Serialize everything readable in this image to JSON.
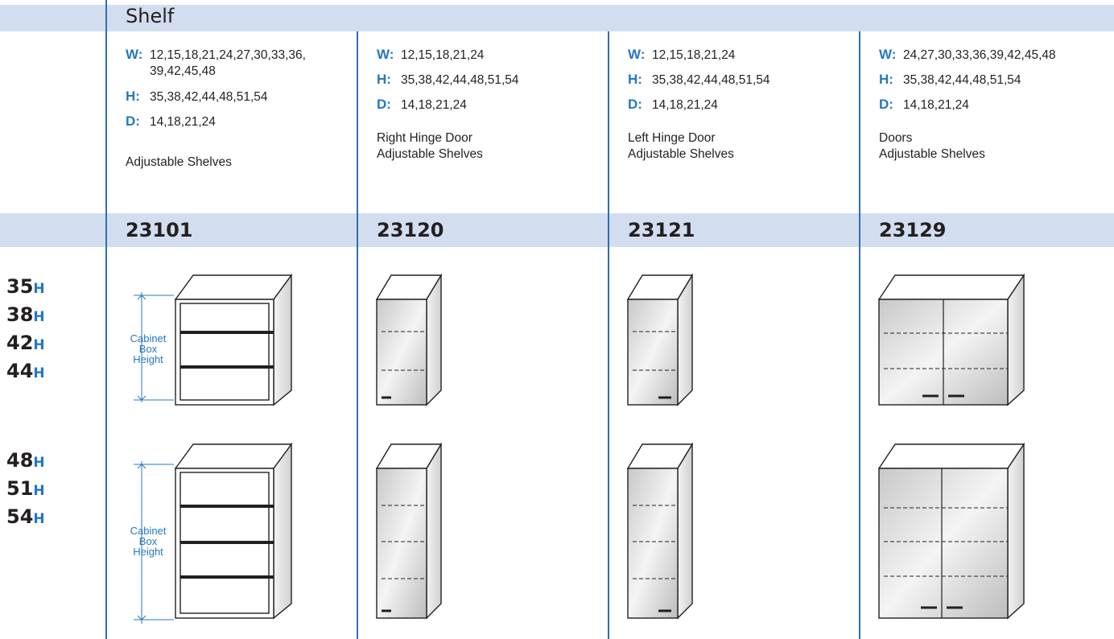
{
  "section_title": "Shelf",
  "columns": [
    {
      "code": "23101",
      "specs": [
        {
          "key": "W:",
          "value": "12,15,18,21,24,27,30,33,36,",
          "cont": "39,42,45,48"
        },
        {
          "key": "H:",
          "value": "35,38,42,44,48,51,54"
        },
        {
          "key": "D:",
          "value": "14,18,21,24"
        }
      ],
      "desc": [
        "Adjustable Shelves"
      ]
    },
    {
      "code": "23120",
      "specs": [
        {
          "key": "W:",
          "value": "12,15,18,21,24"
        },
        {
          "key": "H:",
          "value": "35,38,42,44,48,51,54"
        },
        {
          "key": "D:",
          "value": "14,18,21,24"
        }
      ],
      "desc": [
        "Right Hinge Door",
        "Adjustable Shelves"
      ]
    },
    {
      "code": "23121",
      "specs": [
        {
          "key": "W:",
          "value": "12,15,18,21,24"
        },
        {
          "key": "H:",
          "value": "35,38,42,44,48,51,54"
        },
        {
          "key": "D:",
          "value": "14,18,21,24"
        }
      ],
      "desc": [
        "Left Hinge Door",
        "Adjustable Shelves"
      ]
    },
    {
      "code": "23129",
      "specs": [
        {
          "key": "W:",
          "value": "24,27,30,33,36,39,42,45,48"
        },
        {
          "key": "H:",
          "value": "35,38,42,44,48,51,54"
        },
        {
          "key": "D:",
          "value": "14,18,21,24"
        }
      ],
      "desc": [
        "Doors",
        "Adjustable Shelves"
      ]
    }
  ],
  "height_groups": [
    [
      {
        "num": "35",
        "unit": "H"
      },
      {
        "num": "38",
        "unit": "H"
      },
      {
        "num": "42",
        "unit": "H"
      },
      {
        "num": "44",
        "unit": "H"
      }
    ],
    [
      {
        "num": "48",
        "unit": "H"
      },
      {
        "num": "51",
        "unit": "H"
      },
      {
        "num": "54",
        "unit": "H"
      }
    ]
  ],
  "cabinet_box_label": [
    "Cabinet",
    "Box",
    "Height"
  ],
  "colors": {
    "band": "#d3ddf0",
    "accent": "#2477c2",
    "rule": "#2f6fb0",
    "text": "#231f20"
  }
}
